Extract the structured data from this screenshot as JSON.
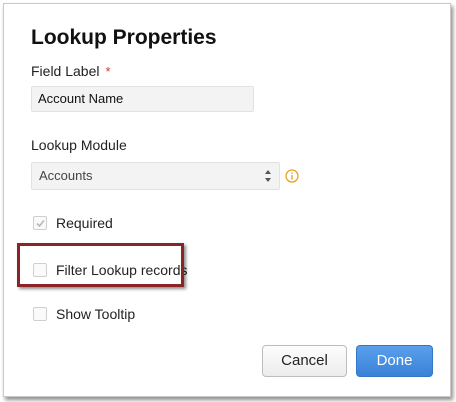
{
  "dialog": {
    "title": "Lookup Properties"
  },
  "field_label": {
    "label": "Field Label",
    "required_marker": "*",
    "value": "Account Name"
  },
  "lookup_module": {
    "label": "Lookup Module",
    "selected": "Accounts",
    "info_icon": "info-circle-icon"
  },
  "options": {
    "required": {
      "label": "Required",
      "checked": true,
      "disabled": true
    },
    "filter_lookup_records": {
      "label": "Filter Lookup records",
      "checked": false,
      "highlighted": true
    },
    "show_tooltip": {
      "label": "Show Tooltip",
      "checked": false
    }
  },
  "buttons": {
    "cancel": "Cancel",
    "done": "Done"
  },
  "colors": {
    "required_star": "#e0302b",
    "highlight_border": "#8b2525",
    "primary_button": "#3a82d8",
    "info_icon": "#e8a21f"
  }
}
